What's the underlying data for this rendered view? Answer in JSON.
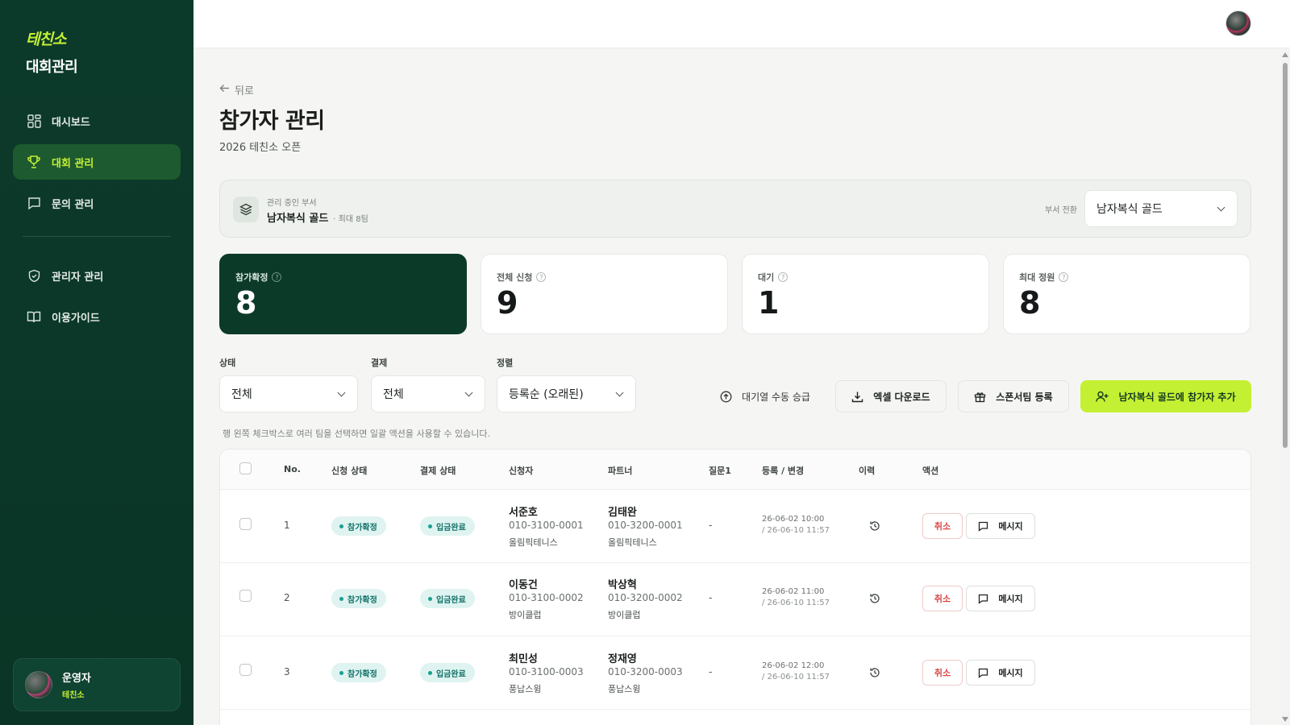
{
  "sidebar": {
    "brand_logo": "테친소",
    "brand_title": "대회관리",
    "nav": [
      {
        "label": "대시보드",
        "icon": "dashboard-icon",
        "active": false
      },
      {
        "label": "대회 관리",
        "icon": "trophy-icon",
        "active": true
      },
      {
        "label": "문의 관리",
        "icon": "chat-icon",
        "active": false
      }
    ],
    "nav2": [
      {
        "label": "관리자 관리",
        "icon": "shield-icon"
      },
      {
        "label": "이용가이드",
        "icon": "book-icon"
      }
    ],
    "user": {
      "name": "운영자",
      "org": "테친소"
    }
  },
  "header": {
    "back_label": "뒤로",
    "title": "참가자 관리",
    "subtitle": "2026 테친소 오픈"
  },
  "department": {
    "label": "관리 중인 부서",
    "name": "남자복식 골드",
    "max": "· 최대 8팀",
    "switch_label": "부서 전환",
    "selected": "남자복식 골드"
  },
  "stats": [
    {
      "label": "참가확정",
      "value": "8"
    },
    {
      "label": "전체 신청",
      "value": "9"
    },
    {
      "label": "대기",
      "value": "1"
    },
    {
      "label": "최대 정원",
      "value": "8"
    }
  ],
  "filters": {
    "status": {
      "label": "상태",
      "value": "전체"
    },
    "payment": {
      "label": "결제",
      "value": "전체"
    },
    "sort": {
      "label": "정렬",
      "value": "등록순 (오래된)"
    }
  },
  "actions": {
    "waitlist": "대기열 수동 승급",
    "excel": "엑셀 다운로드",
    "sponsor": "스폰서팀 등록",
    "add": "남자복식 골드에 참가자 추가"
  },
  "hint": "행 왼쪽 체크박스로 여러 팀을 선택하면 일괄 액션을 사용할 수 있습니다.",
  "table": {
    "headers": [
      "No.",
      "신청 상태",
      "결제 상태",
      "신청자",
      "파트너",
      "질문1",
      "등록 / 변경",
      "이력",
      "액션"
    ],
    "cancel_label": "취소",
    "message_label": "메시지",
    "rows": [
      {
        "no": "1",
        "status": "참가확정",
        "payment": "입금완료",
        "applicant": {
          "name": "서준호",
          "phone": "010-3100-0001",
          "club": "올림픽테니스"
        },
        "partner": {
          "name": "김태완",
          "phone": "010-3200-0001",
          "club": "올림픽테니스"
        },
        "q1": "-",
        "registered": "26-06-02 10:00",
        "changed": "/ 26-06-10 11:57"
      },
      {
        "no": "2",
        "status": "참가확정",
        "payment": "입금완료",
        "applicant": {
          "name": "이동건",
          "phone": "010-3100-0002",
          "club": "방이클럽"
        },
        "partner": {
          "name": "박상혁",
          "phone": "010-3200-0002",
          "club": "방이클럽"
        },
        "q1": "-",
        "registered": "26-06-02 11:00",
        "changed": "/ 26-06-10 11:57"
      },
      {
        "no": "3",
        "status": "참가확정",
        "payment": "입금완료",
        "applicant": {
          "name": "최민성",
          "phone": "010-3100-0003",
          "club": "풍납스윙"
        },
        "partner": {
          "name": "정재영",
          "phone": "010-3200-0003",
          "club": "풍납스윙"
        },
        "q1": "-",
        "registered": "26-06-02 12:00",
        "changed": "/ 26-06-10 11:57"
      }
    ]
  }
}
